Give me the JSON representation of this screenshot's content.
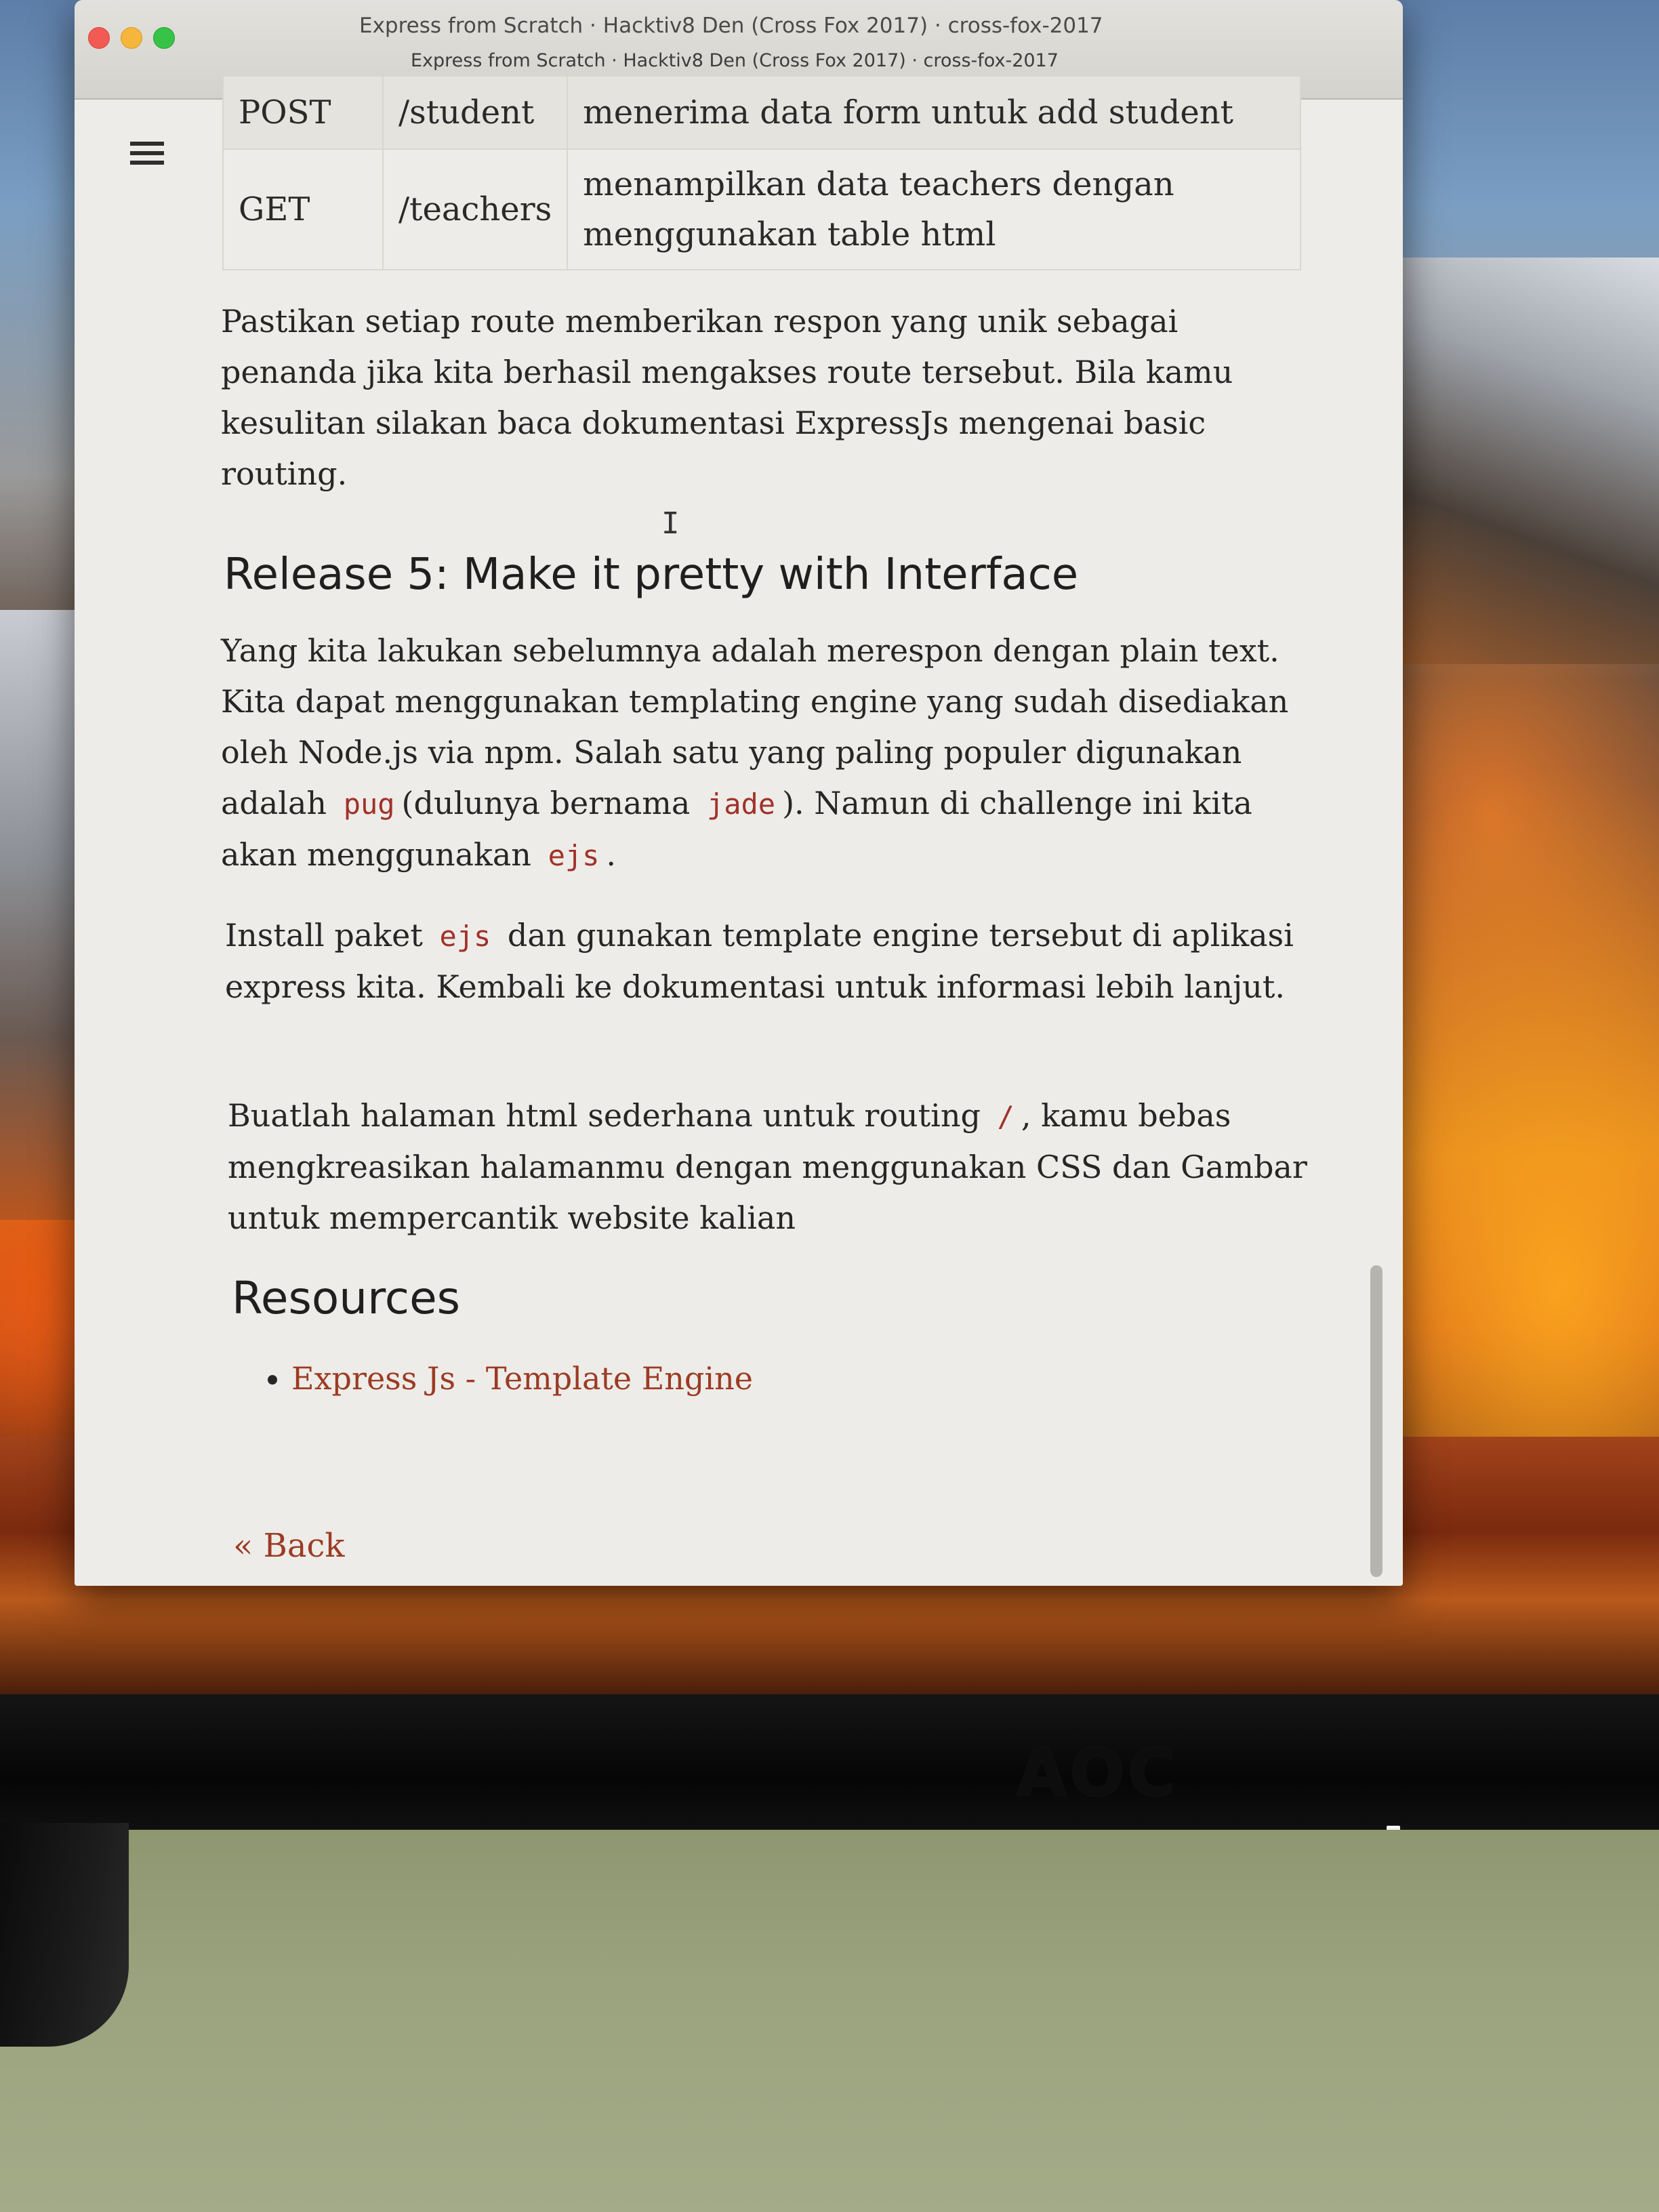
{
  "window": {
    "title": "Express from Scratch · Hacktiv8 Den (Cross Fox 2017) · cross-fox-2017",
    "tab_title": "Express from Scratch · Hacktiv8 Den (Cross Fox 2017) · cross-fox-2017"
  },
  "routes_table": {
    "rows": [
      {
        "method": "POST",
        "path": "/student",
        "description": "menerima data form untuk add student"
      },
      {
        "method": "GET",
        "path": "/teachers",
        "description": "menampilkan data teachers dengan menggunakan table html"
      }
    ]
  },
  "content": {
    "intro_paragraph": "Pastikan setiap route memberikan respon yang unik sebagai penanda jika kita berhasil mengakses route tersebut. Bila kamu kesulitan silakan baca dokumentasi ExpressJs mengenai basic routing.",
    "release5_heading": "Release 5: Make it pretty with Interface",
    "release5_p1_a": "Yang kita lakukan sebelumnya adalah merespon dengan plain text. Kita dapat menggunakan templating engine yang sudah disediakan oleh Node.js via npm. Salah satu yang paling populer digunakan adalah",
    "release5_p1_code1": "pug",
    "release5_p1_b": "(dulunya bernama",
    "release5_p1_code2": "jade",
    "release5_p1_c": "). Namun di challenge ini kita akan menggunakan",
    "release5_p1_code3": "ejs",
    "release5_p1_d": ".",
    "release5_p2_a": "Install paket",
    "release5_p2_code": "ejs",
    "release5_p2_b": "dan gunakan template engine tersebut di aplikasi express kita. Kembali ke dokumentasi untuk informasi lebih lanjut.",
    "release5_p3_a": "Buatlah halaman html sederhana untuk routing",
    "release5_p3_code": "/",
    "release5_p3_b": ", kamu bebas mengkreasikan halamanmu dengan menggunakan CSS dan Gambar untuk mempercantik website kalian",
    "resources_heading": "Resources",
    "resources_links": [
      "Express Js - Template Engine"
    ],
    "back_link": "« Back"
  },
  "monitor": {
    "brand": "AOC"
  },
  "colors": {
    "link": "#9c3b24",
    "inline_code": "#a0322a",
    "close_button": "#f25b53",
    "minimize_button": "#f6b63b",
    "maximize_button": "#37c348"
  },
  "icons": [
    "hamburger-menu-icon",
    "text-cursor-icon"
  ]
}
